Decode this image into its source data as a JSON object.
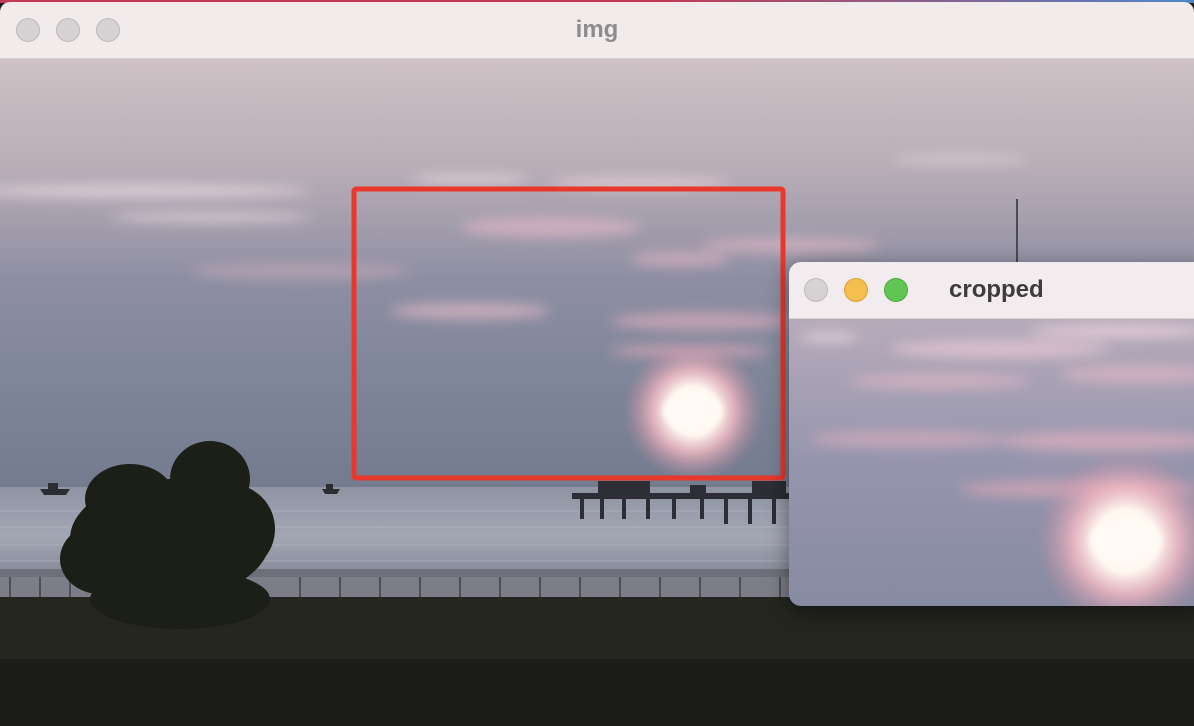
{
  "main_window": {
    "title": "img"
  },
  "crop_window": {
    "title": "cropped"
  },
  "colors": {
    "selection_rect": "#e8382b",
    "traffic_light_inactive": "#d6d2d3",
    "traffic_light_close": "#d6d2d3",
    "traffic_light_minimize": "#f4bf4f",
    "traffic_light_zoom": "#61c554"
  },
  "icons": [
    "close-icon",
    "minimize-icon",
    "zoom-icon"
  ]
}
